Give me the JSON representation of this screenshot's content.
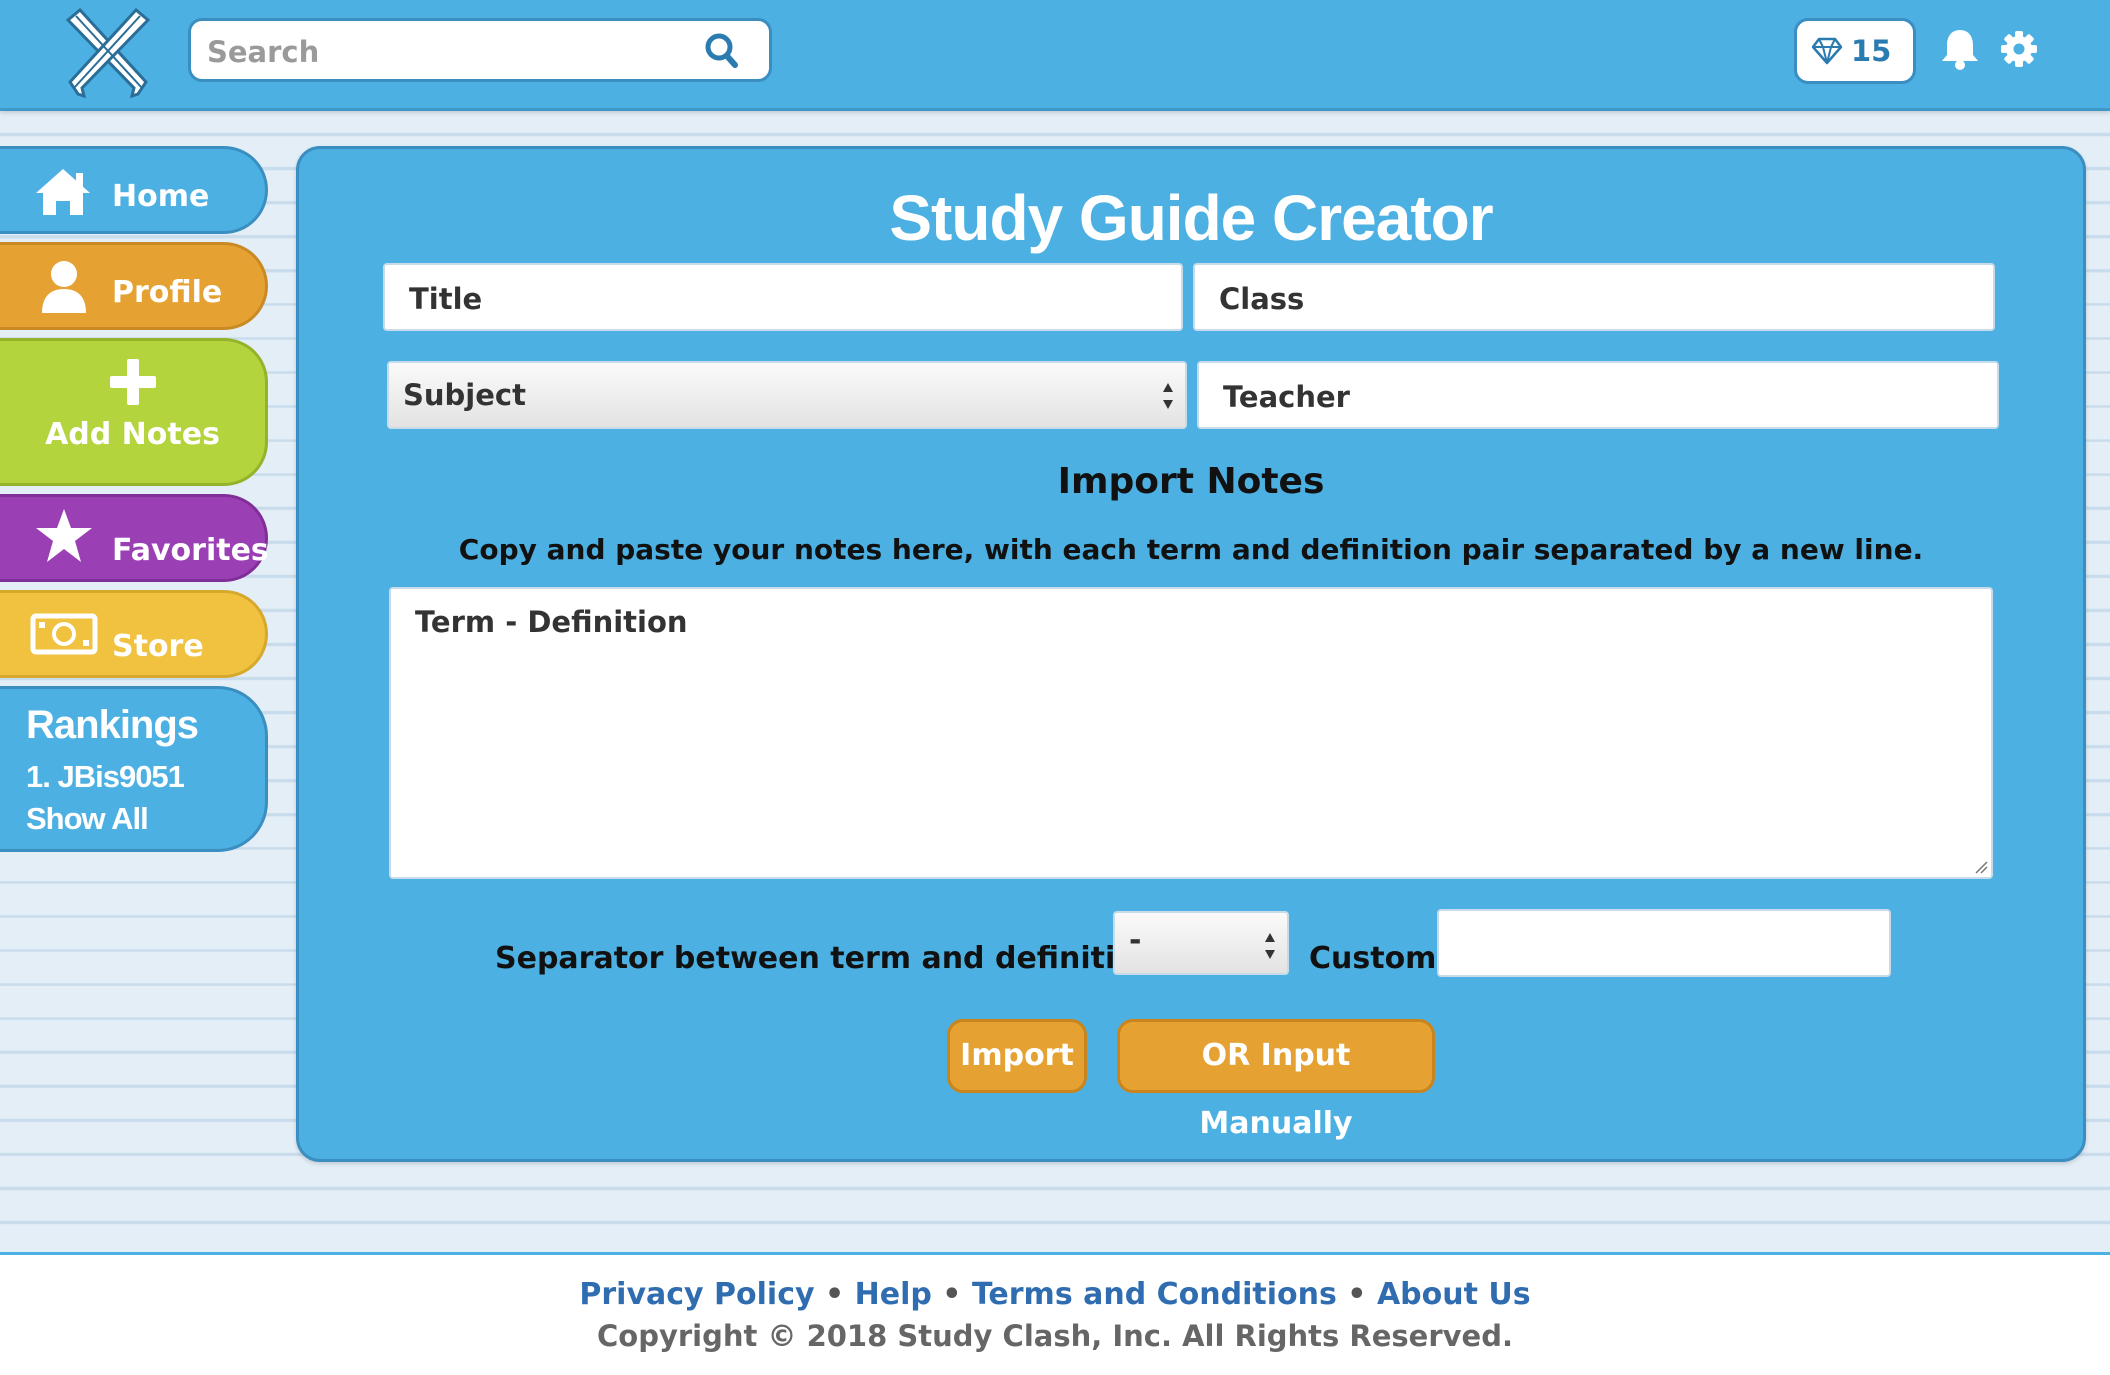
{
  "header": {
    "search_placeholder": "Search",
    "gem_count": "15"
  },
  "sidebar": {
    "items": [
      {
        "label": "Home",
        "icon": "home-icon",
        "color": "#4db0e2"
      },
      {
        "label": "Profile",
        "icon": "user-icon",
        "color": "#e5a232"
      },
      {
        "label": "Add Notes",
        "icon": "plus-icon",
        "color": "#b4d43e"
      },
      {
        "label": "Favorites",
        "icon": "star-icon",
        "color": "#9b3fb5"
      },
      {
        "label": "Store",
        "icon": "dollar-bill-icon",
        "color": "#f0c240"
      }
    ],
    "rankings": {
      "title": "Rankings",
      "entries": [
        "1. JBis9051"
      ],
      "show_all": "Show All"
    }
  },
  "main": {
    "title": "Study Guide Creator",
    "title_placeholder": "Title",
    "class_placeholder": "Class",
    "subject_selected": "Subject",
    "teacher_placeholder": "Teacher",
    "import_heading": "Import Notes",
    "instructions": "Copy and paste your notes here, with each term and definition pair separated by a new line.",
    "notes_placeholder": "Term - Definition",
    "separator_label": "Separator between term and definition",
    "separator_selected": "-",
    "custom_label": "Custom",
    "custom_value": "",
    "import_button": "Import",
    "manual_button": "OR Input Manually"
  },
  "footer": {
    "links": [
      "Privacy Policy",
      "Help",
      "Terms and Conditions",
      "About Us"
    ],
    "separator": "•",
    "copyright": "Copyright © 2018 Study Clash, Inc. All Rights Reserved."
  },
  "colors": {
    "primary_blue": "#4db0e2",
    "accent_orange": "#e5a232",
    "link_blue": "#2f6db0"
  }
}
